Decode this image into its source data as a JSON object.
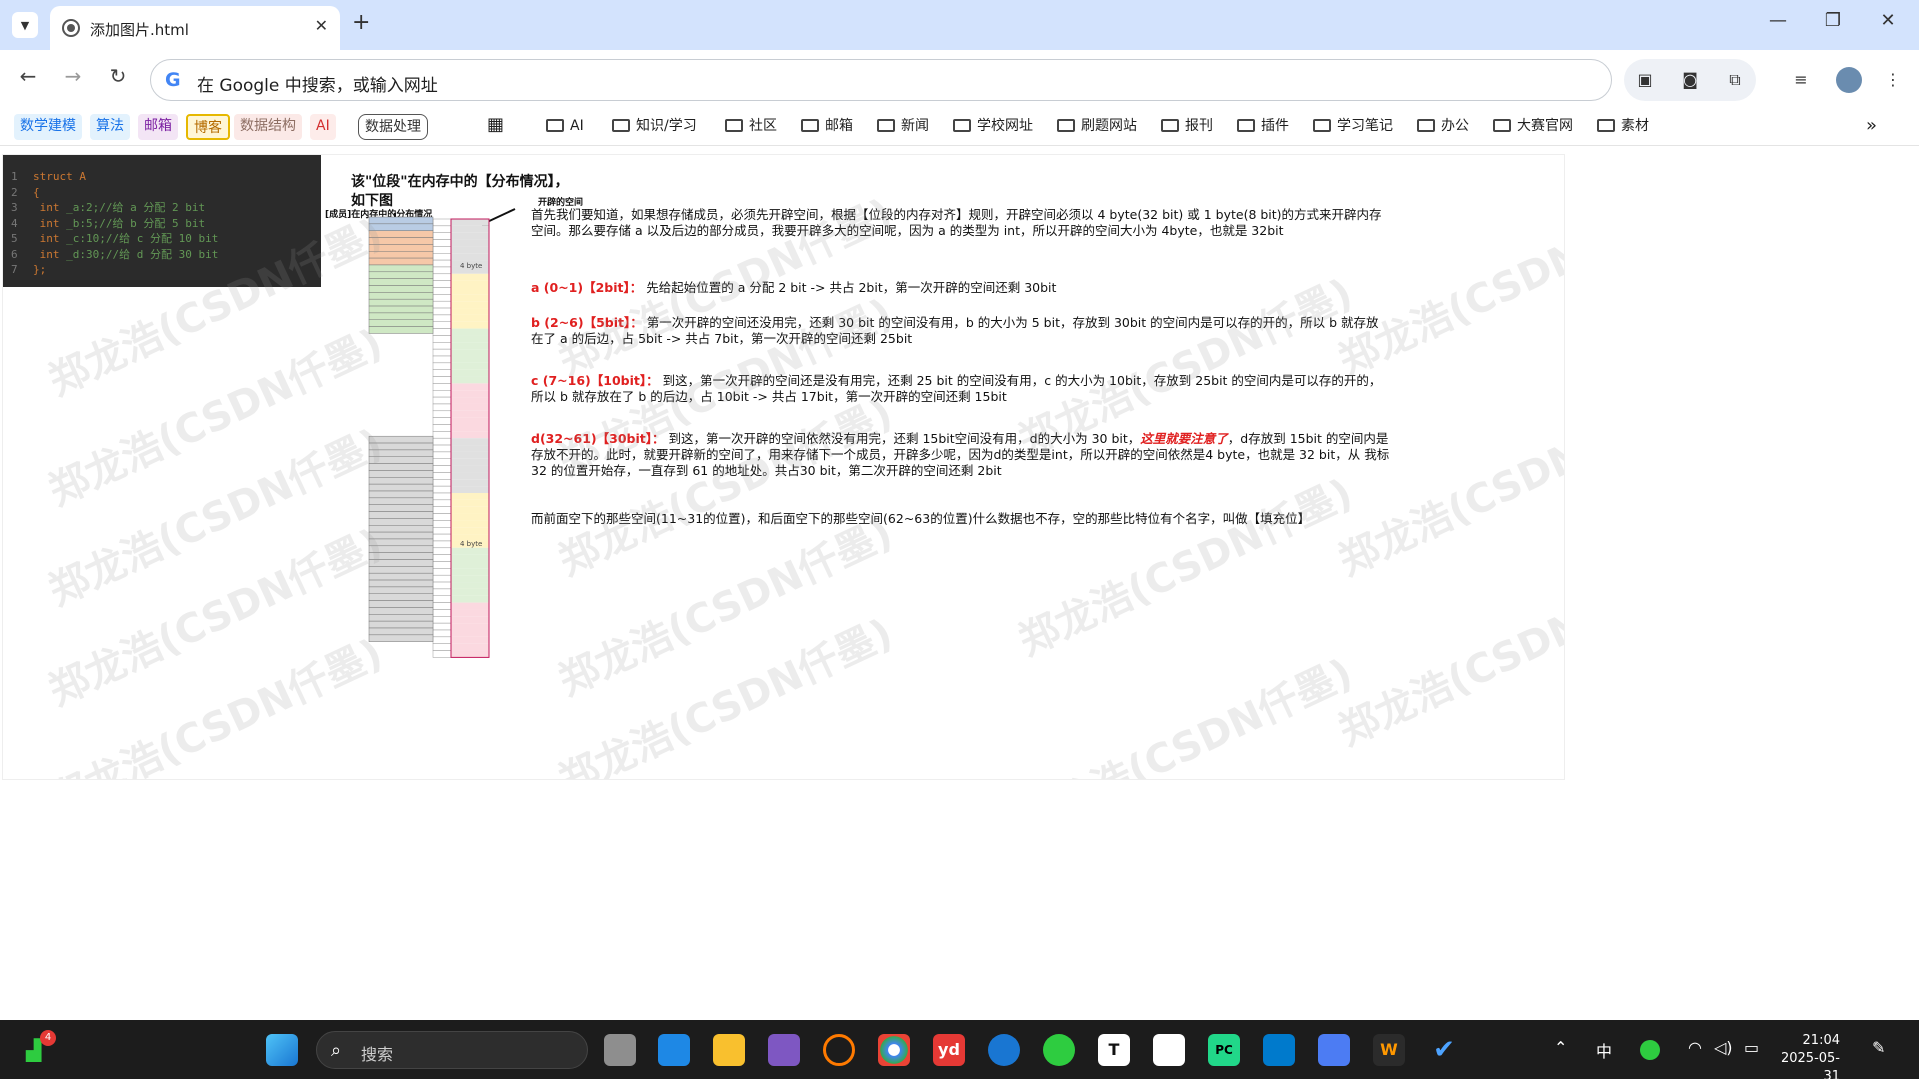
{
  "tab": {
    "title": "添加图片.html",
    "close": "✕"
  },
  "new_tab": "+",
  "window": {
    "minimize": "—",
    "restore": "❐",
    "close": "✕"
  },
  "omnibox": {
    "placeholder": "在 Google 中搜索，或输入网址",
    "g": "G"
  },
  "bookmarks": {
    "chips": [
      {
        "label": "数学建模",
        "color": "#1a73e8",
        "bg": "#e3f2fd"
      },
      {
        "label": "算法",
        "color": "#1a73e8",
        "bg": "#e3f2fd"
      },
      {
        "label": "邮箱",
        "color": "#7b1fa2",
        "bg": "#f3e5f5"
      },
      {
        "label": "博客",
        "color": "#b56b00",
        "bg": "#fff6d5"
      },
      {
        "label": "数据结构",
        "color": "#8d6e63",
        "bg": "#fbe9e7"
      },
      {
        "label": "AI",
        "color": "#d32f2f",
        "bg": "#fdecea"
      },
      {
        "label": "数据处理",
        "color": "#333333",
        "bg": "#ffffff"
      }
    ],
    "folders": [
      "AI",
      "知识/学习",
      "社区",
      "邮箱",
      "新闻",
      "学校网址",
      "刷题网站",
      "报刊",
      "插件",
      "学习笔记",
      "办公",
      "大赛官网",
      "素材"
    ],
    "more": "»"
  },
  "image": {
    "code_lines": [
      {
        "n": "1",
        "kw": "struct A",
        "rest": ""
      },
      {
        "n": "2",
        "kw": "{",
        "rest": ""
      },
      {
        "n": "3",
        "kw": " int",
        "rest": " _a:2;//给 a 分配 2 bit"
      },
      {
        "n": "4",
        "kw": " int",
        "rest": " _b:5;//给 b 分配 5 bit"
      },
      {
        "n": "5",
        "kw": " int",
        "rest": " _c:10;//给 c 分配 10 bit"
      },
      {
        "n": "6",
        "kw": " int",
        "rest": " _d:30;//给 d 分配 30 bit"
      },
      {
        "n": "7",
        "kw": "};",
        "rest": ""
      }
    ],
    "heading1": "该\"位段\"在内存中的【分布情况】，",
    "heading2": "如下图",
    "label_members": "[成员]在内存中的分布情况",
    "label_space": "开辟的空间",
    "byte_label": "4 byte",
    "p1": "首先我们要知道，如果想存储成员，必须先开辟空间，根据【位段的内存对齐】规则，开辟空间必须以 4 byte(32 bit) 或 1 byte(8 bit)的方式来开辟内存空间。那么要存储 a 以及后边的部分成员，我要开辟多大的空间呢，因为 a 的类型为 int，所以开辟的空间大小为 4byte，也就是 32bit",
    "p2_head": "a (0~1)【2bit】：",
    "p2": "先给起始位置的 a 分配 2 bit -> 共占 2bit，第一次开辟的空间还剩 30bit",
    "p3_head": "b (2~6)【5bit】：",
    "p3": "第一次开辟的空间还没用完，还剩 30 bit 的空间没有用，b 的大小为 5 bit，存放到 30bit 的空间内是可以存的开的，所以 b 就存放在了 a 的后边，占 5bit -> 共占 7bit，第一次开辟的空间还剩 25bit",
    "p4_head": "c (7~16)【10bit】：",
    "p4": "到这，第一次开辟的空间还是没有用完，还剩 25 bit 的空间没有用，c 的大小为 10bit，存放到 25bit 的空间内是可以存的开的，所以 b 就存放在了 b 的后边，占 10bit -> 共占 17bit，第一次开辟的空间还剩 15bit",
    "p5_head": "d(32~61)【30bit】：",
    "p5a": "到这，第一次开辟的空间依然没有用完，还剩 15bit空间没有用，d的大小为 30 bit，",
    "p5_red": "这里就要注意了",
    "p5b": "，d存放到 15bit 的空间内是存放不开的。此时，就要开辟新的空间了，用来存储下一个成员，开辟多少呢，因为d的类型是int，所以开辟的空间依然是4 byte，也就是 32 bit，从 我标 32 的位置开始存，一直存到 61 的地址处。共占30 bit，第二次开辟的空间还剩 2bit",
    "p6": "而前面空下的那些空间(11~31的位置)，和后面空下的那些空间(62~63的位置)什么数据也不存，空的那些比特位有个名字，叫做【填充位】",
    "watermark": "郑龙浩(CSDN仟墨)"
  },
  "taskbar": {
    "search_label": "搜索",
    "badge": "4",
    "time": "21:04",
    "date": "2025-05-31",
    "ime": "中"
  }
}
